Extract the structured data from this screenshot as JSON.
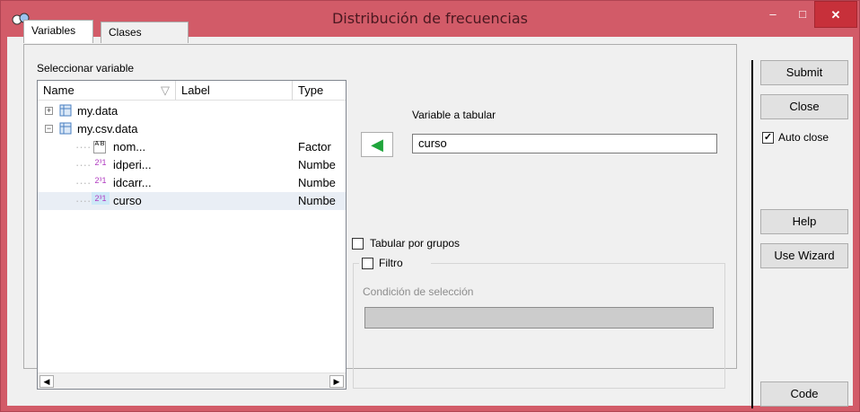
{
  "window": {
    "title": "Distribución de frecuencias",
    "minimize_glyph": "–",
    "maximize_glyph": "□",
    "close_glyph": "✕"
  },
  "tabs": [
    {
      "label": "Variables",
      "active": true
    },
    {
      "label": "Clases",
      "active": false
    }
  ],
  "variables_panel": {
    "select_label": "Seleccionar variable",
    "columns": [
      "Name",
      "Label",
      "Type"
    ],
    "tree": [
      {
        "name": "my.data",
        "type": "",
        "expander": "+",
        "icon": "dataset-icon"
      },
      {
        "name": "my.csv.data",
        "type": "",
        "expander": "−",
        "icon": "dataset-icon"
      },
      {
        "name": "nom...",
        "type": "Factor",
        "icon": "factor-icon",
        "icon_text": "A B"
      },
      {
        "name": "idperi...",
        "type": "Numbe",
        "icon": "numeric-icon",
        "icon_text": "2³1"
      },
      {
        "name": "idcarr...",
        "type": "Numbe",
        "icon": "numeric-icon",
        "icon_text": "2³1"
      },
      {
        "name": "curso",
        "type": "Numbe",
        "icon": "numeric-icon",
        "icon_text": "2³1",
        "selected": true
      }
    ]
  },
  "variable_a_tabular": {
    "label": "Variable a tabular",
    "value": "curso"
  },
  "tabular_por_grupos": {
    "label": "Tabular por grupos",
    "checked": false
  },
  "filtro": {
    "label": "Filtro",
    "checked": false,
    "condition_label": "Condición de selección",
    "condition_value": ""
  },
  "buttons": {
    "submit": "Submit",
    "close": "Close",
    "auto_close": "Auto close",
    "auto_close_checked": true,
    "help": "Help",
    "use_wizard": "Use Wizard",
    "code": "Code"
  },
  "colors": {
    "titlebar": "#d25b68",
    "close_button": "#c7303a",
    "arrow_green": "#1fa53c",
    "selected_row": "#e9eef5"
  }
}
